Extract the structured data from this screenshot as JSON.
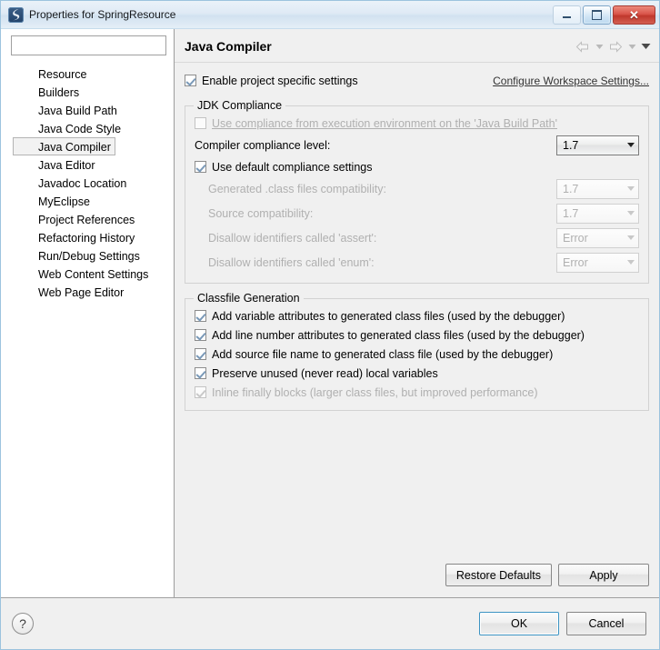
{
  "window": {
    "title": "Properties for SpringResource",
    "icon": "myeclipse-icon",
    "controls": {
      "minimize": "minimize-button",
      "maximize": "maximize-button",
      "close": "close-button"
    }
  },
  "sidebar": {
    "filter": {
      "value": "",
      "placeholder": ""
    },
    "items": [
      {
        "label": "Resource",
        "selected": false
      },
      {
        "label": "Builders",
        "selected": false
      },
      {
        "label": "Java Build Path",
        "selected": false
      },
      {
        "label": "Java Code Style",
        "selected": false
      },
      {
        "label": "Java Compiler",
        "selected": true
      },
      {
        "label": "Java Editor",
        "selected": false
      },
      {
        "label": "Javadoc Location",
        "selected": false
      },
      {
        "label": "MyEclipse",
        "selected": false
      },
      {
        "label": "Project References",
        "selected": false
      },
      {
        "label": "Refactoring History",
        "selected": false
      },
      {
        "label": "Run/Debug Settings",
        "selected": false
      },
      {
        "label": "Web Content Settings",
        "selected": false
      },
      {
        "label": "Web Page Editor",
        "selected": false
      }
    ]
  },
  "page": {
    "title": "Java Compiler",
    "nav": {
      "back": "back-arrow-icon",
      "back_menu": "back-dropdown-icon",
      "forward": "forward-arrow-icon",
      "forward_menu": "forward-dropdown-icon",
      "view_menu": "view-menu-chevron-icon"
    },
    "enable_specific": {
      "label": "Enable project specific settings",
      "checked": true,
      "enabled": true
    },
    "configure_workspace_link": "Configure Workspace Settings...",
    "jdk_compliance": {
      "group_title": "JDK Compliance",
      "use_execution_env": {
        "label_before": "Use compliance from execution environment on the ",
        "label_link": "'Java Build Path'",
        "label_full": "Use compliance from execution environment on the 'Java Build Path'",
        "checked": false,
        "enabled": false
      },
      "compliance_level": {
        "label": "Compiler compliance level:",
        "value": "1.7",
        "enabled": true
      },
      "use_default": {
        "label": "Use default compliance settings",
        "checked": true,
        "enabled": true
      },
      "fields": [
        {
          "label": "Generated .class files compatibility:",
          "value": "1.7",
          "enabled": false
        },
        {
          "label": "Source compatibility:",
          "value": "1.7",
          "enabled": false
        },
        {
          "label": "Disallow identifiers called 'assert':",
          "value": "Error",
          "enabled": false
        },
        {
          "label": "Disallow identifiers called 'enum':",
          "value": "Error",
          "enabled": false
        }
      ]
    },
    "classfile_generation": {
      "group_title": "Classfile Generation",
      "options": [
        {
          "label": "Add variable attributes to generated class files (used by the debugger)",
          "checked": true,
          "enabled": true
        },
        {
          "label": "Add line number attributes to generated class files (used by the debugger)",
          "checked": true,
          "enabled": true
        },
        {
          "label": "Add source file name to generated class file (used by the debugger)",
          "checked": true,
          "enabled": true
        },
        {
          "label": "Preserve unused (never read) local variables",
          "checked": true,
          "enabled": true
        },
        {
          "label": "Inline finally blocks (larger class files, but improved performance)",
          "checked": true,
          "enabled": false
        }
      ]
    },
    "restore_defaults_button": "Restore Defaults",
    "apply_button": "Apply"
  },
  "footer": {
    "help_icon": "help-icon",
    "help_glyph": "?",
    "ok_button": "OK",
    "cancel_button": "Cancel"
  },
  "colors": {
    "frame_border": "#9cc3de",
    "close_button": "#c0372c",
    "focus_border": "#3c93c2",
    "content_bg": "#f0f0f0",
    "tree_bg": "#ffffff",
    "check_mark": "#7a99b8",
    "disabled_text": "#b0b0b0"
  }
}
